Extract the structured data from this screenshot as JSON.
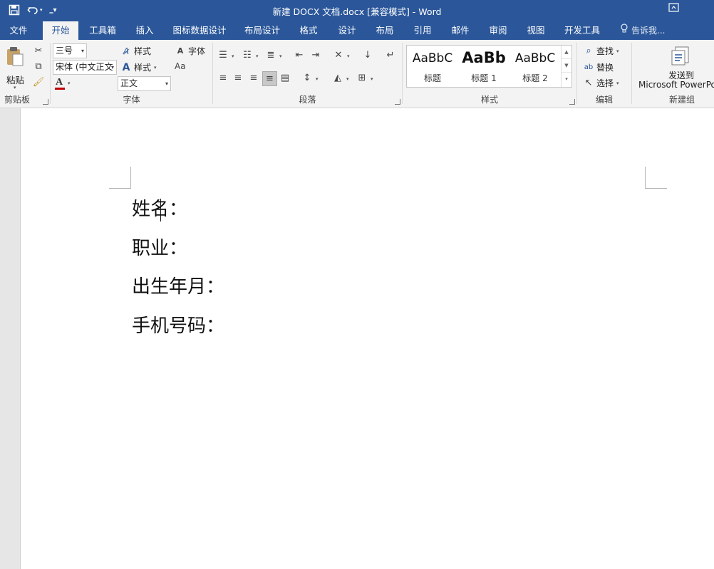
{
  "window": {
    "title": "新建 DOCX 文档.docx [兼容模式] - Word"
  },
  "quick_access": {
    "icons": [
      "save-icon",
      "undo-icon",
      "customize-icon"
    ]
  },
  "tabs": [
    {
      "label": "文件"
    },
    {
      "label": "开始",
      "active": true
    },
    {
      "label": "工具箱"
    },
    {
      "label": "插入"
    },
    {
      "label": "图标数据设计"
    },
    {
      "label": "布局设计"
    },
    {
      "label": "格式"
    },
    {
      "label": "设计"
    },
    {
      "label": "布局"
    },
    {
      "label": "引用"
    },
    {
      "label": "邮件"
    },
    {
      "label": "审阅"
    },
    {
      "label": "视图"
    },
    {
      "label": "开发工具"
    }
  ],
  "tell_me": "告诉我...",
  "ribbon": {
    "clipboard": {
      "paste_label": "粘贴",
      "group_label": "剪贴板"
    },
    "font": {
      "size_value": "三号",
      "font_value": "宋体 (中文正文",
      "style_value": "正文",
      "style_btn1": "样式",
      "style_btn2": "样式",
      "font_btn": "字体",
      "change_case": "Aa",
      "font_color": "A",
      "group_label": "字体"
    },
    "paragraph": {
      "group_label": "段落"
    },
    "styles": {
      "items": [
        {
          "sample": "AaBbC",
          "name": "标题"
        },
        {
          "sample": "AaBb",
          "name": "标题 1"
        },
        {
          "sample": "AaBbC",
          "name": "标题 2"
        }
      ],
      "group_label": "样式"
    },
    "editing": {
      "find": "查找",
      "replace": "替换",
      "select": "选择",
      "group_label": "编辑"
    },
    "newgroup": {
      "send_label": "发送到",
      "send_sub": "Microsoft PowerPo",
      "group_label": "新建组"
    }
  },
  "document": {
    "lines": [
      {
        "text_before": "姓名",
        "text_after": "：",
        "has_caret": true
      },
      {
        "text": "职业："
      },
      {
        "text": "出生年月："
      },
      {
        "text": "手机号码："
      }
    ]
  },
  "colors": {
    "brand": "#2b579a",
    "font_color_bar": "#c00000"
  }
}
